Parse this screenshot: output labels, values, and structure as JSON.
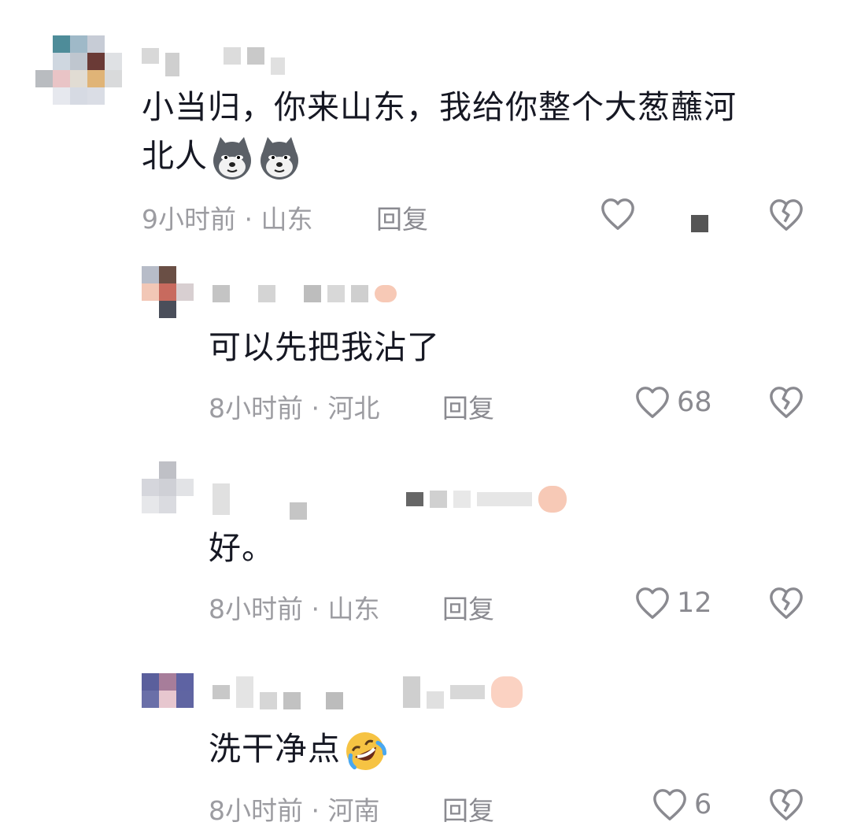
{
  "comments": [
    {
      "text_lines": [
        "小当归，你来山东，我给你整个大葱蘸河",
        "北人"
      ],
      "emoji": [
        "wolf-face-emoji",
        "wolf-face-emoji"
      ],
      "time": "9小时前",
      "location": "山东",
      "reply_label": "回复",
      "likes": ""
    },
    {
      "text": "可以先把我沾了",
      "time": "8小时前",
      "location": "河北",
      "reply_label": "回复",
      "likes": "68"
    },
    {
      "text": "好。",
      "time": "8小时前",
      "location": "山东",
      "reply_label": "回复",
      "likes": "12"
    },
    {
      "text": "洗干净点",
      "emoji": [
        "rolling-laughing-emoji"
      ],
      "time": "8小时前",
      "location": "河南",
      "reply_label": "回复",
      "likes": "6"
    }
  ],
  "meta_separator": " · ",
  "icons": {
    "like": "heart-outline-icon",
    "dislike": "broken-heart-icon"
  },
  "colors": {
    "text": "#161823",
    "meta": "#9c9ca1",
    "icon": "#8a8a90"
  }
}
